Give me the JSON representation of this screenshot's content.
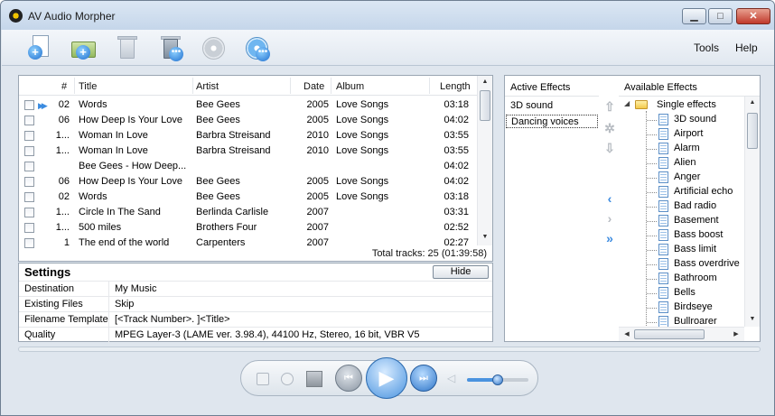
{
  "window": {
    "title": "AV Audio Morpher"
  },
  "title_buttons": {
    "minimize": "▁",
    "maximize": "□",
    "close": "✕"
  },
  "toolbar": {
    "buttons": [
      "new-document-icon",
      "add-folder-icon",
      "delete-icon",
      "delete-options-icon",
      "disc-icon",
      "disc-options-icon"
    ]
  },
  "menu": {
    "tools": "Tools",
    "help": "Help"
  },
  "tracks": {
    "columns": {
      "num": "#",
      "title": "Title",
      "artist": "Artist",
      "date": "Date",
      "album": "Album",
      "length": "Length"
    },
    "rows": [
      {
        "num": "02",
        "title": "Words",
        "artist": "Bee Gees",
        "date": "2005",
        "album": "Love Songs",
        "length": "03:18",
        "playing": true
      },
      {
        "num": "06",
        "title": "How Deep Is Your Love",
        "artist": "Bee Gees",
        "date": "2005",
        "album": "Love Songs",
        "length": "04:02"
      },
      {
        "num": "1...",
        "title": "Woman In Love",
        "artist": "Barbra Streisand",
        "date": "2010",
        "album": "Love Songs",
        "length": "03:55"
      },
      {
        "num": "1...",
        "title": "Woman In Love",
        "artist": "Barbra Streisand",
        "date": "2010",
        "album": "Love Songs",
        "length": "03:55"
      },
      {
        "num": "",
        "title": "Bee Gees - How Deep...",
        "artist": "",
        "date": "",
        "album": "",
        "length": "04:02"
      },
      {
        "num": "06",
        "title": "How Deep Is Your Love",
        "artist": "Bee Gees",
        "date": "2005",
        "album": "Love Songs",
        "length": "04:02"
      },
      {
        "num": "02",
        "title": "Words",
        "artist": "Bee Gees",
        "date": "2005",
        "album": "Love Songs",
        "length": "03:18"
      },
      {
        "num": "1...",
        "title": "Circle In The Sand",
        "artist": "Berlinda Carlisle",
        "date": "2007",
        "album": "",
        "length": "03:31"
      },
      {
        "num": "1...",
        "title": "500 miles",
        "artist": "Brothers Four",
        "date": "2007",
        "album": "",
        "length": "02:52"
      },
      {
        "num": "1",
        "title": "The end of the world",
        "artist": "Carpenters",
        "date": "2007",
        "album": "",
        "length": "02:27"
      }
    ],
    "total": "Total tracks: 25 (01:39:58)"
  },
  "settings": {
    "title": "Settings",
    "hide_label": "Hide",
    "rows": [
      {
        "label": "Destination",
        "value": "My Music"
      },
      {
        "label": "Existing Files",
        "value": "Skip"
      },
      {
        "label": "Filename Template",
        "value": "[<Track Number>. ]<Title>"
      },
      {
        "label": "Quality",
        "value": "MPEG Layer-3 (LAME ver. 3.98.4), 44100 Hz, Stereo, 16 bit, VBR V5"
      }
    ]
  },
  "effects": {
    "active_header": "Active Effects",
    "available_header": "Available Effects",
    "active": [
      "3D sound",
      "Dancing voices"
    ],
    "active_selected_index": 1,
    "group": "Single effects",
    "available": [
      "3D sound",
      "Airport",
      "Alarm",
      "Alien",
      "Anger",
      "Artificial echo",
      "Bad radio",
      "Basement",
      "Bass boost",
      "Bass limit",
      "Bass overdrive",
      "Bathroom",
      "Bells",
      "Birdseye",
      "Bullroarer"
    ],
    "mid_buttons": [
      "move-up-icon",
      "settings-icon",
      "move-down-icon",
      "remove-all-icon",
      "add-one-icon",
      "add-all-icon"
    ]
  },
  "player": {
    "volume": 0.5,
    "prev": "⏮",
    "play": "▶",
    "next": "⏭"
  }
}
